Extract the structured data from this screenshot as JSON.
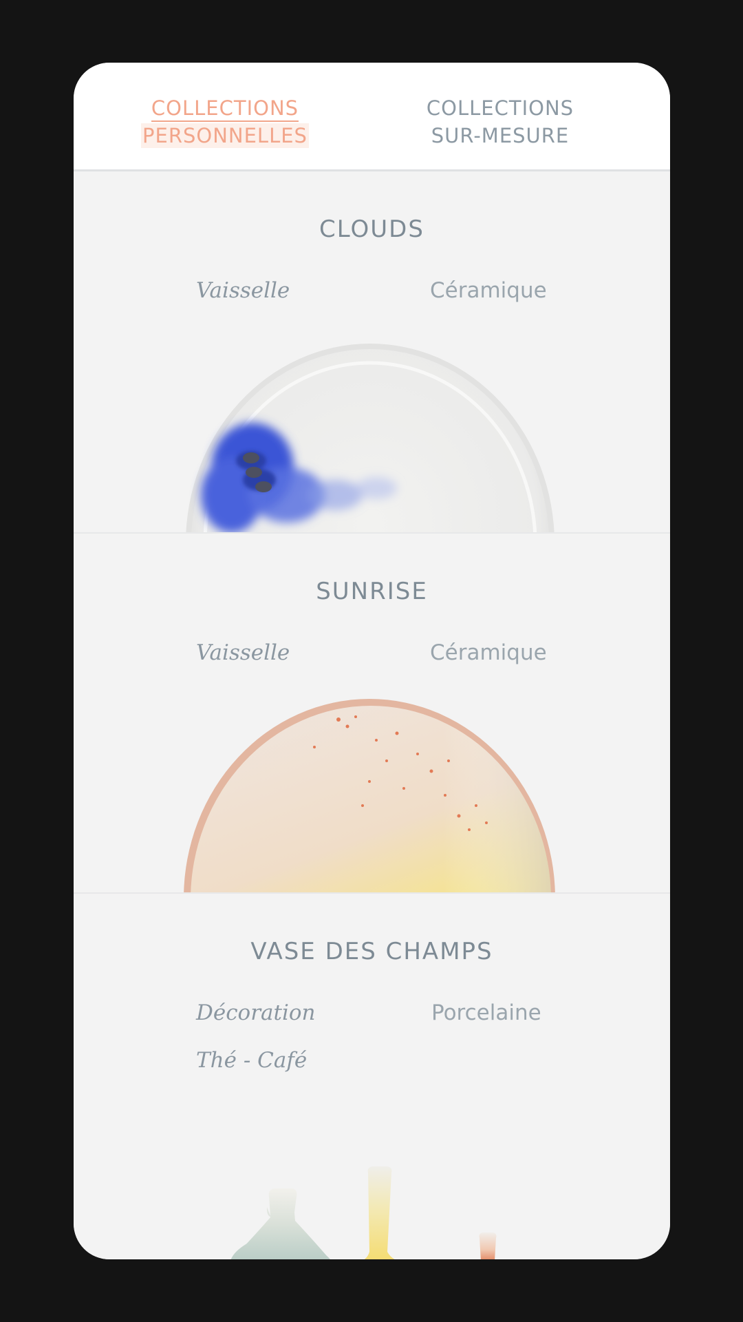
{
  "tabs": [
    {
      "line1": "COLLECTIONS",
      "line2": "PERSONNELLES",
      "active": true
    },
    {
      "line1": "COLLECTIONS",
      "line2": "SUR-MESURE",
      "active": false
    }
  ],
  "collections": [
    {
      "title": "CLOUDS",
      "categories": [
        "Vaisselle"
      ],
      "material": "Céramique",
      "image": "blue-ink-plate"
    },
    {
      "title": "SUNRISE",
      "categories": [
        "Vaisselle"
      ],
      "material": "Céramique",
      "image": "sunrise-speckled-plate"
    },
    {
      "title": "VASE DES CHAMPS",
      "categories": [
        "Décoration",
        "Thé - Café"
      ],
      "material": "Porcelaine",
      "image": "gradient-vases"
    }
  ],
  "colors": {
    "accent": "#f2a58a",
    "text_muted": "#8a96a0",
    "background": "#f3f3f3",
    "frame": "#141414"
  }
}
